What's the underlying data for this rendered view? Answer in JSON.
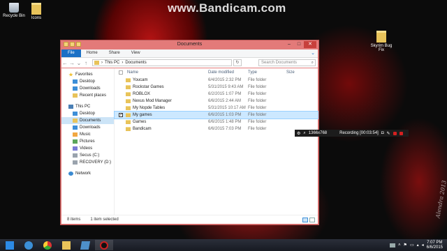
{
  "watermark": "www.Bandicam.com",
  "signature": "Alendra 2013",
  "desktop": {
    "icons": [
      {
        "label": "Recycle Bin"
      },
      {
        "label": "Icons"
      },
      {
        "label": "Skyrim Bug Fix"
      }
    ]
  },
  "window": {
    "title": "Documents",
    "ribbon_tabs": [
      "File",
      "Home",
      "Share",
      "View"
    ],
    "nav_back": "←",
    "nav_forward": "→",
    "nav_up": "↑",
    "breadcrumb": [
      "This PC",
      "Documents"
    ],
    "search_placeholder": "Search Documents"
  },
  "navpane": {
    "favorites_header": "Favorites",
    "favorites": [
      "Desktop",
      "Downloads",
      "Recent places"
    ],
    "thispc_header": "This PC",
    "thispc": [
      "Desktop",
      "Documents",
      "Downloads",
      "Music",
      "Pictures",
      "Videos",
      "Secus (C:)",
      "RECOVERY (D:)"
    ],
    "network": "Network"
  },
  "columns": {
    "name": "Name",
    "date": "Date modified",
    "type": "Type",
    "size": "Size"
  },
  "files": [
    {
      "name": "Youcam",
      "date": "6/4/2015 2:32 PM",
      "type": "File folder"
    },
    {
      "name": "Rockstar Games",
      "date": "5/31/2015 9:43 AM",
      "type": "File folder"
    },
    {
      "name": "ROBLOX",
      "date": "6/2/2015 1:07 PM",
      "type": "File folder"
    },
    {
      "name": "Nexus Mod Manager",
      "date": "6/6/2015 2:44 AM",
      "type": "File folder"
    },
    {
      "name": "My Nopde Tables",
      "date": "5/31/2015 10:17 AM",
      "type": "File folder"
    },
    {
      "name": "My games",
      "date": "6/6/2015 1:03 PM",
      "type": "File folder"
    },
    {
      "name": "Games",
      "date": "6/6/2015 1:48 PM",
      "type": "File folder"
    },
    {
      "name": "Bandicam",
      "date": "6/6/2015 7:03 PM",
      "type": "File folder"
    }
  ],
  "status": {
    "count": "8 items",
    "selection": "1 item selected"
  },
  "recbar": {
    "resolution": "1366x768",
    "status": "Recording [00:03:54]"
  },
  "taskbar": {
    "time": "7:07 PM",
    "date": "6/6/2015"
  }
}
